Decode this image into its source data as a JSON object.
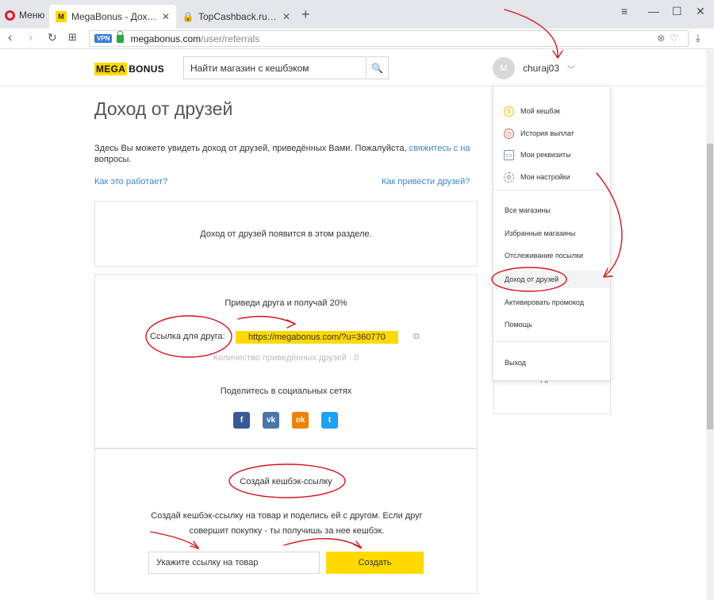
{
  "browser": {
    "menu_label": "Меню",
    "tabs": [
      {
        "title": "MegaBonus - Доход от друзей",
        "favicon": "megabonus-favicon"
      },
      {
        "title": "TopCashback.ru - Топ лучших кешбэк сервисов",
        "favicon": "lock-icon"
      }
    ],
    "url_host": "megabonus.com",
    "url_path": "/user/referrals",
    "vpn_label": "VPN"
  },
  "header": {
    "logo_mega": "MEGA",
    "logo_bonus": "BONUS",
    "search_placeholder": "Найти магазин с кешбэком",
    "avatar_letter": "M",
    "username": "churaj03"
  },
  "page": {
    "title": "Доход от друзей",
    "intro_text": "Здесь Вы можете увидеть доход от друзей, приведённых Вами. Пожалуйста, ",
    "intro_link": "свяжитесь с на",
    "intro_tail": "вопросы.",
    "link_how": "Как это работает?",
    "link_bring": "Как привести друзей?"
  },
  "income_box": {
    "text": "Доход от друзей появится в этом разделе."
  },
  "referral_box": {
    "heading": "Приведи друга и получай 20%",
    "link_label": "Ссылка для друга:",
    "link_value": "https://megabonus.com/?u=360770",
    "count_text": "Количество приведённых друзей : 0",
    "share_heading": "Поделитесь в социальных сетях",
    "socials": [
      {
        "name": "facebook",
        "glyph": "f"
      },
      {
        "name": "vk",
        "glyph": "vk"
      },
      {
        "name": "odnoklassniki",
        "glyph": "ok"
      },
      {
        "name": "twitter",
        "glyph": "t"
      }
    ]
  },
  "cashback_box": {
    "heading": "Создай кешбэк-ссылку",
    "description": "Создай кешбэк-ссылку на товар и поделись ей с другом. Если друг совершит покупку - ты получишь за нее кешбэк.",
    "input_placeholder": "Укажите ссылку на товар",
    "button_label": "Создать"
  },
  "side_panel": {
    "more_link": "Подробнее"
  },
  "dropdown": {
    "top_items": [
      {
        "label": "Мой кешбэк",
        "icon": "cashback-icon"
      },
      {
        "label": "История выплат",
        "icon": "history-icon"
      },
      {
        "label": "Мои реквизиты",
        "icon": "requisites-icon"
      },
      {
        "label": "Мои настройки",
        "icon": "settings-icon"
      }
    ],
    "nav_items": [
      {
        "label": "Все магазины"
      },
      {
        "label": "Избранные магазины"
      },
      {
        "label": "Отслеживание посылки"
      },
      {
        "label": "Доход от друзей"
      },
      {
        "label": "Активировать промокод"
      },
      {
        "label": "Помощь"
      }
    ],
    "logout": "Выход"
  },
  "colors": {
    "brand_yellow": "#ffd900",
    "link_blue": "#3a87c8",
    "annotation_red": "#d4141c"
  }
}
